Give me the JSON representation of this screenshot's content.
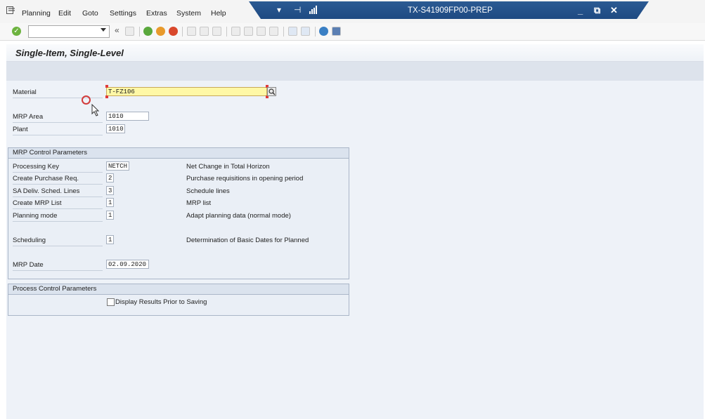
{
  "menu": {
    "items": [
      {
        "label": "Planning"
      },
      {
        "label": "Edit"
      },
      {
        "label": "Goto"
      },
      {
        "label": "Settings"
      },
      {
        "label": "Extras"
      },
      {
        "label": "System"
      },
      {
        "label": "Help"
      }
    ]
  },
  "titlebar": {
    "title": "TX-S41909FP00-PREP"
  },
  "page": {
    "title": "Single-Item, Single-Level"
  },
  "fields": {
    "material": {
      "label": "Material",
      "value": "T-FZ106"
    },
    "mrp_area": {
      "label": "MRP Area",
      "value": "1010"
    },
    "plant": {
      "label": "Plant",
      "value": "1010"
    }
  },
  "mrp_control": {
    "title": "MRP Control Parameters",
    "rows": [
      {
        "label": "Processing Key",
        "value": "NETCH",
        "desc": "Net Change in Total Horizon"
      },
      {
        "label": "Create Purchase Req.",
        "value": "2",
        "desc": "Purchase requisitions in opening period"
      },
      {
        "label": "SA Deliv. Sched. Lines",
        "value": "3",
        "desc": "Schedule lines"
      },
      {
        "label": "Create MRP List",
        "value": "1",
        "desc": "MRP list"
      },
      {
        "label": "Planning mode",
        "value": "1",
        "desc": "Adapt planning data (normal mode)"
      },
      {
        "label": "Scheduling",
        "value": "1",
        "desc": "Determination of Basic Dates for Planned"
      },
      {
        "label": "MRP Date",
        "value": "02.09.2020",
        "desc": ""
      }
    ]
  },
  "process_control": {
    "title": "Process Control Parameters",
    "display_results_label": "Display Results Prior to Saving"
  },
  "colors": {
    "titlebar": "#1e4a82",
    "required_field": "#fff8a6",
    "background": "#eef2f8"
  }
}
